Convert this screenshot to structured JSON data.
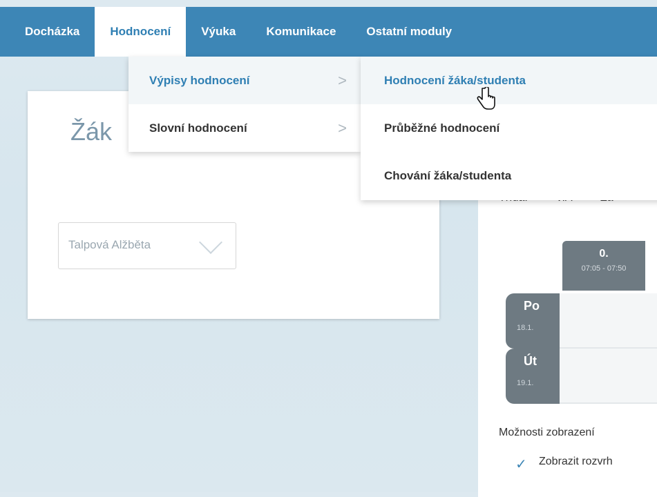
{
  "nav": {
    "items": [
      {
        "label": "Docházka"
      },
      {
        "label": "Hodnocení"
      },
      {
        "label": "Výuka"
      },
      {
        "label": "Komunikace"
      },
      {
        "label": "Ostatní moduly"
      }
    ],
    "active_index": 1
  },
  "menu": {
    "level1": [
      {
        "label": "Výpisy hodnocení",
        "chevron": ">"
      },
      {
        "label": "Slovní hodnocení",
        "chevron": ">"
      }
    ],
    "level2": [
      {
        "label": "Hodnocení žáka/studenta"
      },
      {
        "label": "Průběžné hodnocení"
      },
      {
        "label": "Chování žáka/studenta"
      }
    ]
  },
  "left_panel": {
    "title": "Žák",
    "student_select": {
      "value": "Talpová Alžběta"
    }
  },
  "right_panel": {
    "class_label": "Třída:",
    "class_value": "V.A",
    "next_label": "Za",
    "lesson": {
      "number": "0.",
      "time": "07:05 - 07:50"
    },
    "days": [
      {
        "name": "Po",
        "date": "18.1."
      },
      {
        "name": "Út",
        "date": "19.1."
      }
    ],
    "options_label": "Možnosti zobrazení",
    "show_option": "Zobrazit rozvrh"
  },
  "colors": {
    "accent": "#3d86b6",
    "accent_text": "#2f7fb3",
    "day_bg": "#6e7a82"
  }
}
